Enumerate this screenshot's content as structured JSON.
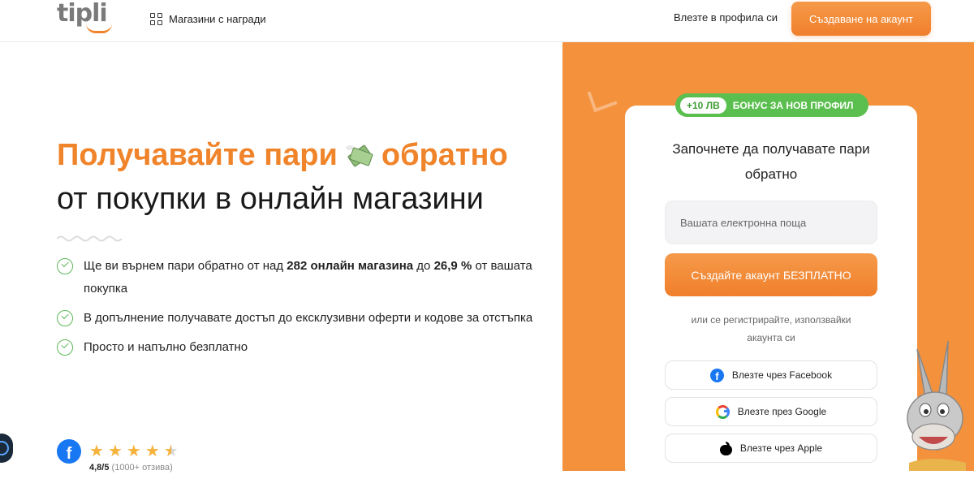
{
  "header": {
    "logo_text": "tipli",
    "stores_link": "Магазини с награди",
    "login_link": "Влезте в профила си",
    "signup_button": "Създаване на акаунт"
  },
  "hero": {
    "title_line1_part1": "Получавайте пари",
    "title_line1_part2": "обратно",
    "title_line2": "от покупки в онлайн магазини",
    "benefits": [
      {
        "prefix": "Ще ви върнем пари обратно от над ",
        "bold1": "282 онлайн магазина",
        "middle": " до ",
        "bold2": "26,9 %",
        "suffix": " от вашата покупка"
      },
      {
        "text": "В допълнение получавате достъп до ексклузивни оферти и кодове за отстъпка"
      },
      {
        "text": "Просто и напълно безплатно"
      }
    ],
    "rating_value": "4,8/5",
    "rating_count": "(1000+ отзива)",
    "stars": 4.5
  },
  "signup_card": {
    "bonus_amount": "+10 ЛВ",
    "bonus_label": "БОНУС ЗА НОВ ПРОФИЛ",
    "title": "Започнете да получавате пари обратно",
    "email_placeholder": "Вашата електронна поща",
    "create_button": "Създайте акаунт БЕЗПЛАТНО",
    "or_text": "или се регистрирайте, използвайки акаунта си",
    "facebook_button": "Влезте чрез Facebook",
    "google_button": "Влезте през Google",
    "apple_button": "Влезте чрез Apple"
  },
  "colors": {
    "accent_orange": "#f0842a",
    "panel_orange": "#f4913c",
    "bonus_green": "#5bbf4f",
    "check_green": "#5fb85a",
    "facebook_blue": "#1877f2"
  },
  "icons": [
    "grid-icon",
    "money-with-wings-icon",
    "check-circle-icon",
    "facebook-icon",
    "google-icon",
    "apple-icon",
    "star-icon",
    "donkey-mascot"
  ]
}
